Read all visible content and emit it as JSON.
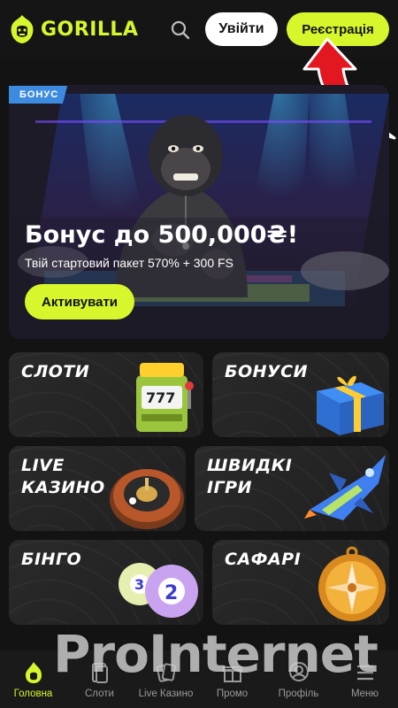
{
  "header": {
    "logo_text": "GORILLA",
    "login_label": "Увійти",
    "register_label": "Реєстрація",
    "accent_color": "#d7f72c"
  },
  "hero": {
    "tag": "БОНУС",
    "title": "Бонус до 500,000₴!",
    "subtitle": "Твій стартовий пакет 570% + 300 FS",
    "button_label": "Активувати"
  },
  "categories": [
    {
      "line1": "СЛОТИ",
      "line2": "",
      "icon": "slot-machine-icon"
    },
    {
      "line1": "БОНУСИ",
      "line2": "",
      "icon": "gift-box-icon"
    },
    {
      "line1": "LIVE",
      "line2": "КАЗИНО",
      "icon": "roulette-wheel-icon"
    },
    {
      "line1": "ШВИДКІ",
      "line2": "ІГРИ",
      "icon": "jet-plane-icon"
    },
    {
      "line1": "БІНГО",
      "line2": "",
      "icon": "bingo-balls-icon"
    },
    {
      "line1": "САФАРІ",
      "line2": "",
      "icon": "compass-icon"
    }
  ],
  "bottom_nav": [
    {
      "label": "Головна",
      "icon": "flame-icon",
      "active": true
    },
    {
      "label": "Слоти",
      "icon": "cards-icon",
      "active": false
    },
    {
      "label": "Live Казино",
      "icon": "live-cards-icon",
      "active": false
    },
    {
      "label": "Промо",
      "icon": "gift-icon",
      "active": false
    },
    {
      "label": "Профіль",
      "icon": "user-icon",
      "active": false
    },
    {
      "label": "Меню",
      "icon": "hamburger-icon",
      "active": false
    }
  ],
  "watermark": "ProInternet"
}
